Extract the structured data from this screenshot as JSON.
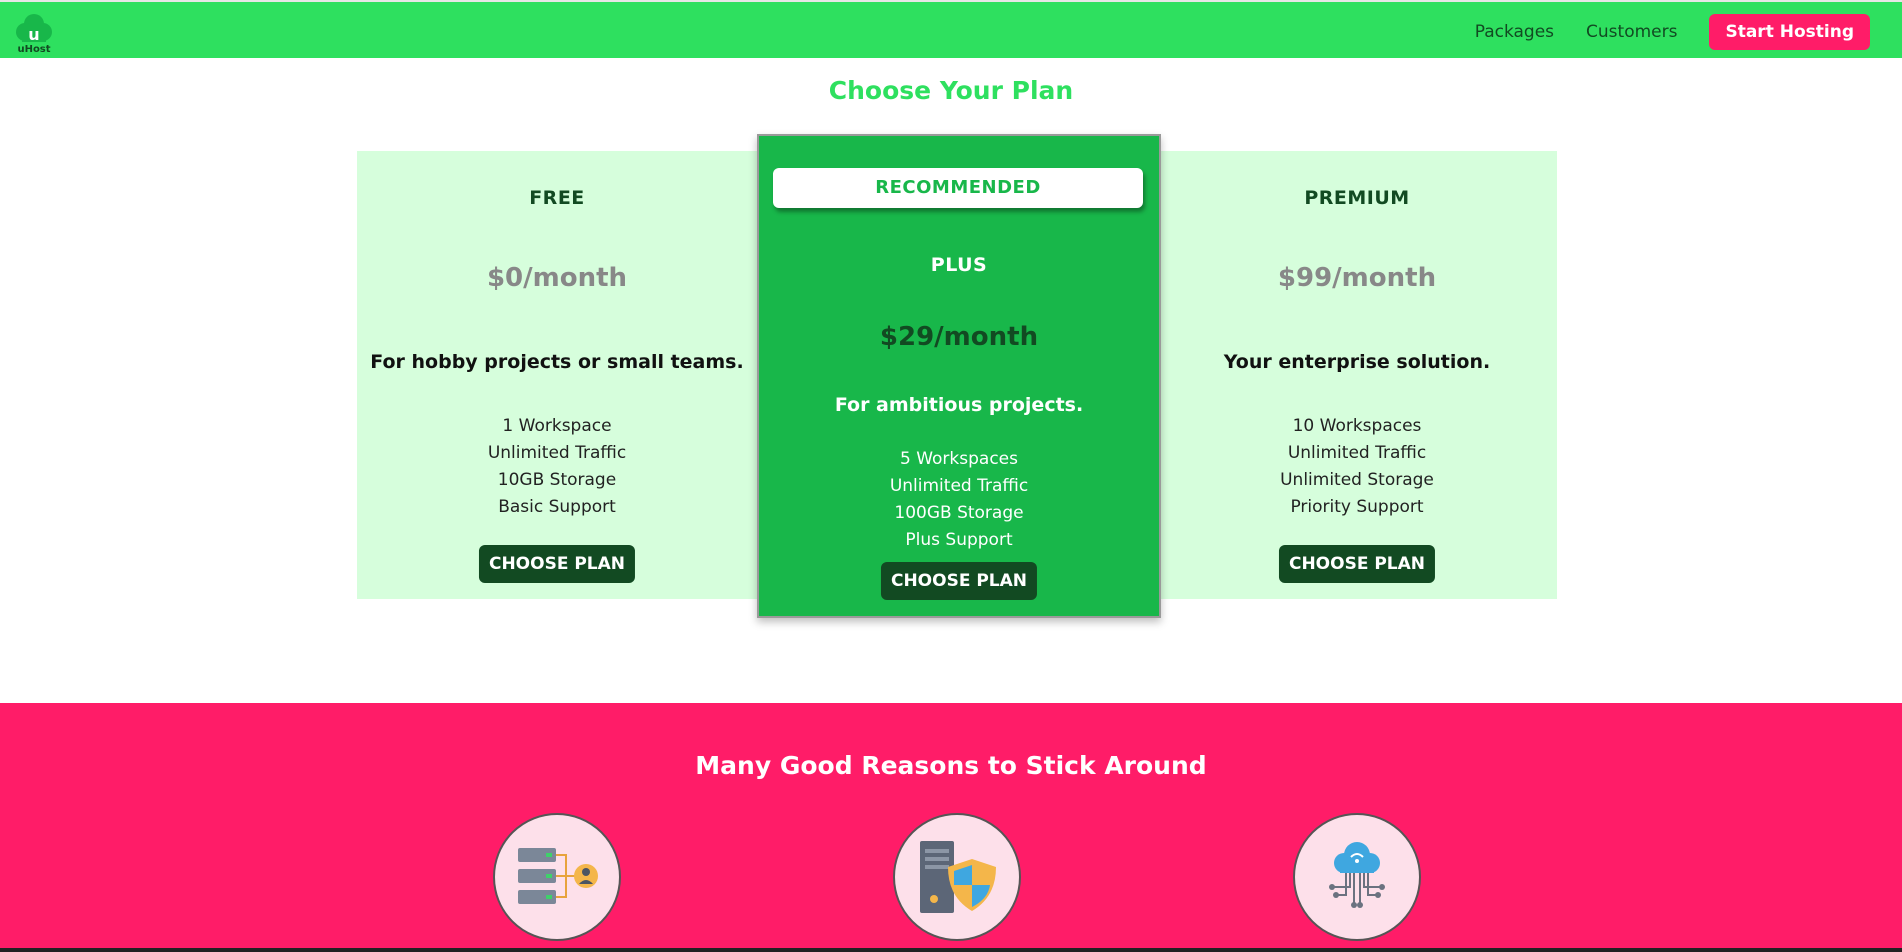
{
  "header": {
    "logo_text": "uHost",
    "nav": [
      "Packages",
      "Customers"
    ],
    "cta_label": "Start Hosting"
  },
  "pricing": {
    "title": "Choose Your Plan",
    "plans": [
      {
        "name": "FREE",
        "price": "$0/month",
        "tagline": "For hobby projects or small teams.",
        "features": [
          "1 Workspace",
          "Unlimited Traffic",
          "10GB Storage",
          "Basic Support"
        ],
        "button": "CHOOSE PLAN"
      },
      {
        "badge": "RECOMMENDED",
        "name": "PLUS",
        "price": "$29/month",
        "tagline": "For ambitious projects.",
        "features": [
          "5 Workspaces",
          "Unlimited Traffic",
          "100GB Storage",
          "Plus Support"
        ],
        "button": "CHOOSE PLAN"
      },
      {
        "name": "PREMIUM",
        "price": "$99/month",
        "tagline": "Your enterprise solution.",
        "features": [
          "10 Workspaces",
          "Unlimited Traffic",
          "Unlimited Storage",
          "Priority Support"
        ],
        "button": "CHOOSE PLAN"
      }
    ]
  },
  "reasons": {
    "title": "Many Good Reasons to Stick Around",
    "icons": [
      "server-network-icon",
      "server-shield-icon",
      "cloud-network-icon"
    ]
  },
  "colors": {
    "header_green": "#2ee05f",
    "light_green": "#d6fedc",
    "plus_green": "#18b74a",
    "dark_green": "#124a22",
    "pink": "#ff1c68"
  }
}
